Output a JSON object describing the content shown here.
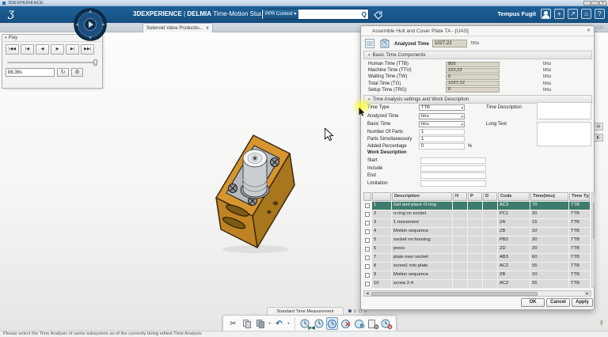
{
  "os": {
    "title": "3DEXPERIENCE"
  },
  "topbar": {
    "brand": "3DEXPERIENCE",
    "separator": "|",
    "app": "DELMIA",
    "app_title": "Time-Motion Study",
    "ppr_context": "PPR Context",
    "search_placeholder": "",
    "user": "Tempus Fugit"
  },
  "tab": {
    "label": "Solenoid Valve Productio...",
    "close": "x"
  },
  "play_panel": {
    "title": "Play",
    "time_value": "88,36s",
    "transport": [
      {
        "name": "jump-to-start",
        "glyph": "|◀◀"
      },
      {
        "name": "step-back",
        "glyph": "|◀"
      },
      {
        "name": "play-backward",
        "glyph": "◀"
      },
      {
        "name": "play-forward",
        "glyph": "▶"
      },
      {
        "name": "step-forward",
        "glyph": "▶|"
      },
      {
        "name": "jump-to-end",
        "glyph": "▶▶|"
      }
    ]
  },
  "dialog": {
    "title": "Assemble Hull and Cover Plate TA - [UAS]",
    "analyzed_time_label": "Analyzed Time",
    "analyzed_time_value": "1027,22",
    "analyzed_time_unit": "tmu",
    "sections": {
      "basic": "Basic Time Components",
      "settings": "Time Analysis settings and Work Description"
    },
    "time_components": [
      {
        "label": "Human Time (TTB)",
        "value": "805",
        "unit": "tmu"
      },
      {
        "label": "Machine Time (TTU)",
        "value": "222,22",
        "unit": "tmu"
      },
      {
        "label": "Waiting Time (TW)",
        "value": "0",
        "unit": "tmu"
      },
      {
        "label": "Total Time (TG)",
        "value": "1027,22",
        "unit": "tmu"
      },
      {
        "label": "Setup Time (TRG)",
        "value": "0",
        "unit": "tmu"
      }
    ],
    "settings": {
      "time_type_label": "Time Type",
      "time_type_value": "TTB",
      "analyzed_time_label": "Analyzed Time",
      "analyzed_time_value": "tmu",
      "basic_time_label": "Basic Time",
      "basic_time_value": "tmu",
      "number_of_parts_label": "Number Of Parts",
      "number_of_parts_value": "1",
      "parts_simultaneously_label": "Parts Simultaneously",
      "parts_simultaneously_value": "1",
      "added_percentage_label": "Added Percentage",
      "added_percentage_value": "0",
      "added_percentage_unit": "%",
      "time_description_label": "Time Description",
      "long_text_label": "Long Text",
      "work_description_label": "Work Description",
      "work_fields": [
        "Start",
        "Include",
        "End",
        "Limitation"
      ]
    },
    "table": {
      "headers": [
        "",
        "",
        "Description",
        "H",
        "P",
        "D",
        "Code",
        "Time(tmu)",
        "Time Type(b"
      ],
      "rows": [
        {
          "num": "1",
          "description": "Get and place O-ring",
          "h": "",
          "p": "",
          "d": "",
          "code": "AC3",
          "time": "70",
          "time_type": "TTB",
          "selected": true
        },
        {
          "num": "2",
          "description": "o-ring on socket",
          "h": "",
          "p": "",
          "d": "",
          "code": "PC1",
          "time": "30",
          "time_type": "TTB"
        },
        {
          "num": "3",
          "description": "1 movement",
          "h": "",
          "p": "",
          "d": "",
          "code": "ZA",
          "time": "15",
          "time_type": "TTB"
        },
        {
          "num": "4",
          "description": "Motion sequence",
          "h": "",
          "p": "",
          "d": "",
          "code": "ZB",
          "time": "10",
          "time_type": "TTB"
        },
        {
          "num": "5",
          "description": "socket on housing",
          "h": "",
          "p": "",
          "d": "",
          "code": "PB2",
          "time": "30",
          "time_type": "TTB"
        },
        {
          "num": "6",
          "description": "press",
          "h": "",
          "p": "",
          "d": "",
          "code": "ZD",
          "time": "20",
          "time_type": "TTB"
        },
        {
          "num": "7",
          "description": "plate over socket",
          "h": "",
          "p": "",
          "d": "",
          "code": "AB3",
          "time": "60",
          "time_type": "TTB"
        },
        {
          "num": "8",
          "description": "screw1 into plate",
          "h": "",
          "p": "",
          "d": "",
          "code": "AC2",
          "time": "55",
          "time_type": "TTB"
        },
        {
          "num": "9",
          "description": "Motion sequence",
          "h": "",
          "p": "",
          "d": "",
          "code": "ZB",
          "time": "10",
          "time_type": "TTB"
        },
        {
          "num": "10",
          "description": "screw 2-4",
          "h": "",
          "p": "",
          "d": "",
          "code": "AC2",
          "time": "55",
          "time_type": "TTB"
        }
      ]
    },
    "buttons": {
      "ok": "OK",
      "cancel": "Cancel",
      "apply": "Apply"
    }
  },
  "bottom_toolbar": {
    "tab_label": "Standard Time Measurement"
  },
  "statusbar": {
    "message": "Please select the Time Analysis of same subsystem as of the currently being edited Time Analysis"
  },
  "icons": {
    "caret_down": "▾",
    "close_x": "✕",
    "minimize": "–",
    "maximize": "▢",
    "search_q": "Q",
    "plus": "+",
    "share": "↗",
    "home": "⌂",
    "help": "?",
    "heart": "♡",
    "cut": "✂",
    "undo": "↶",
    "refresh": "↻",
    "gear": "⚙",
    "tri_left": "◁",
    "tri_right": "▷",
    "arrow_left": "◀",
    "arrow_right": "▶",
    "delete_x": "✕",
    "pencil": "✎"
  },
  "colors": {
    "topbar_blue": "#175a92",
    "selected_row_teal": "#3d7b6e",
    "model_orange": "#d6952f",
    "value_field_beige": "#d9d5c7"
  }
}
